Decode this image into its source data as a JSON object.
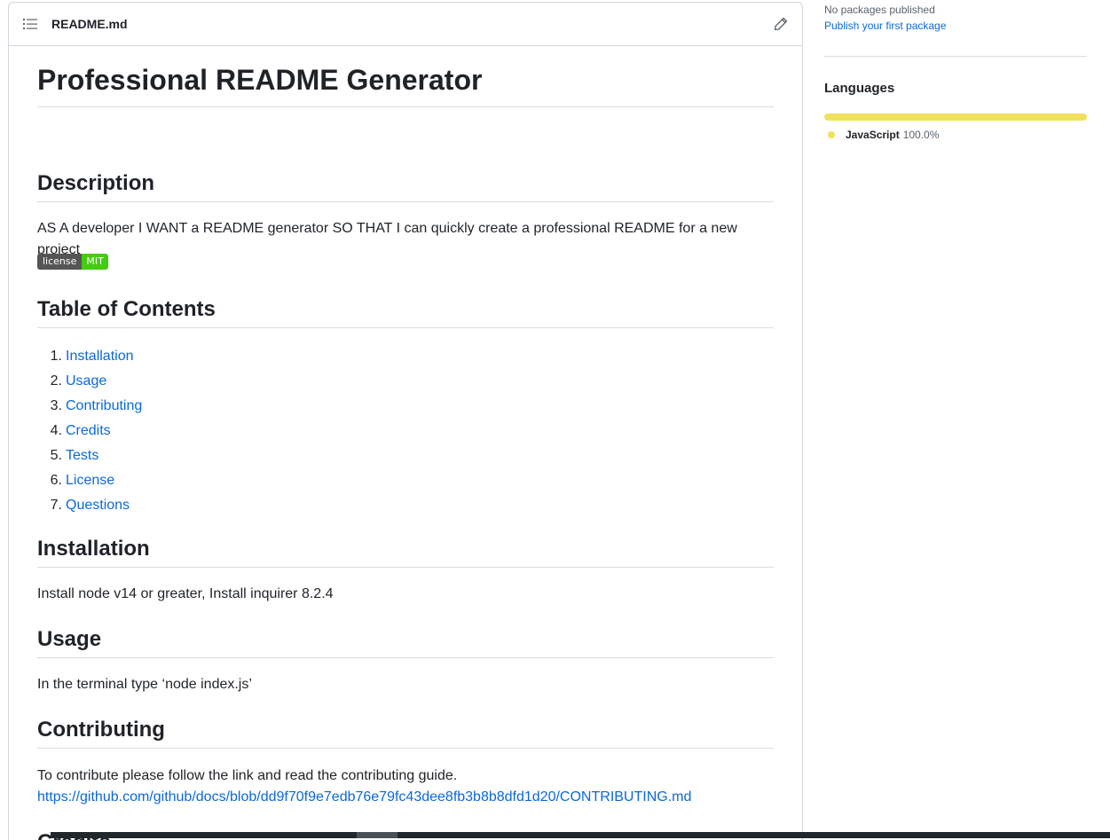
{
  "readme": {
    "filename": "README.md",
    "title": "Professional README Generator",
    "sections": {
      "description": {
        "heading": "Description",
        "text": "AS A developer I WANT a README generator SO THAT I can quickly create a professional README for a new project"
      },
      "badge": {
        "left": "license",
        "right": "MIT"
      },
      "toc": {
        "heading": "Table of Contents",
        "items": [
          {
            "num": "1.",
            "label": "Installation"
          },
          {
            "num": "2.",
            "label": "Usage"
          },
          {
            "num": "3.",
            "label": "Contributing"
          },
          {
            "num": "4.",
            "label": "Credits"
          },
          {
            "num": "5.",
            "label": "Tests"
          },
          {
            "num": "6.",
            "label": "License"
          },
          {
            "num": "7.",
            "label": "Questions"
          }
        ]
      },
      "installation": {
        "heading": "Installation",
        "text": "Install node v14 or greater, Install inquirer 8.2.4"
      },
      "usage": {
        "heading": "Usage",
        "text": "In the terminal type ‘node index.js’"
      },
      "contributing": {
        "heading": "Contributing",
        "text": "To contribute please follow the link and read the contributing guide.",
        "link": "https://github.com/github/docs/blob/dd9f70f9e7edb76e79fc43dee8fb3b8b8dfd1d20/CONTRIBUTING.md"
      },
      "credits": {
        "heading": "Credits"
      }
    }
  },
  "sidebar": {
    "packages_text": "No packages published",
    "packages_link": "Publish your first package",
    "languages_title": "Languages",
    "languages": [
      {
        "name": "JavaScript",
        "percent": "100.0%",
        "color": "#f1e05a",
        "fraction": 1.0
      }
    ]
  },
  "icons": {
    "toc": "list-unordered-icon",
    "edit": "pencil-icon"
  },
  "colors": {
    "link": "#0969da",
    "badge_left": "#555555",
    "badge_right": "#44cc11",
    "javascript": "#f1e05a"
  }
}
